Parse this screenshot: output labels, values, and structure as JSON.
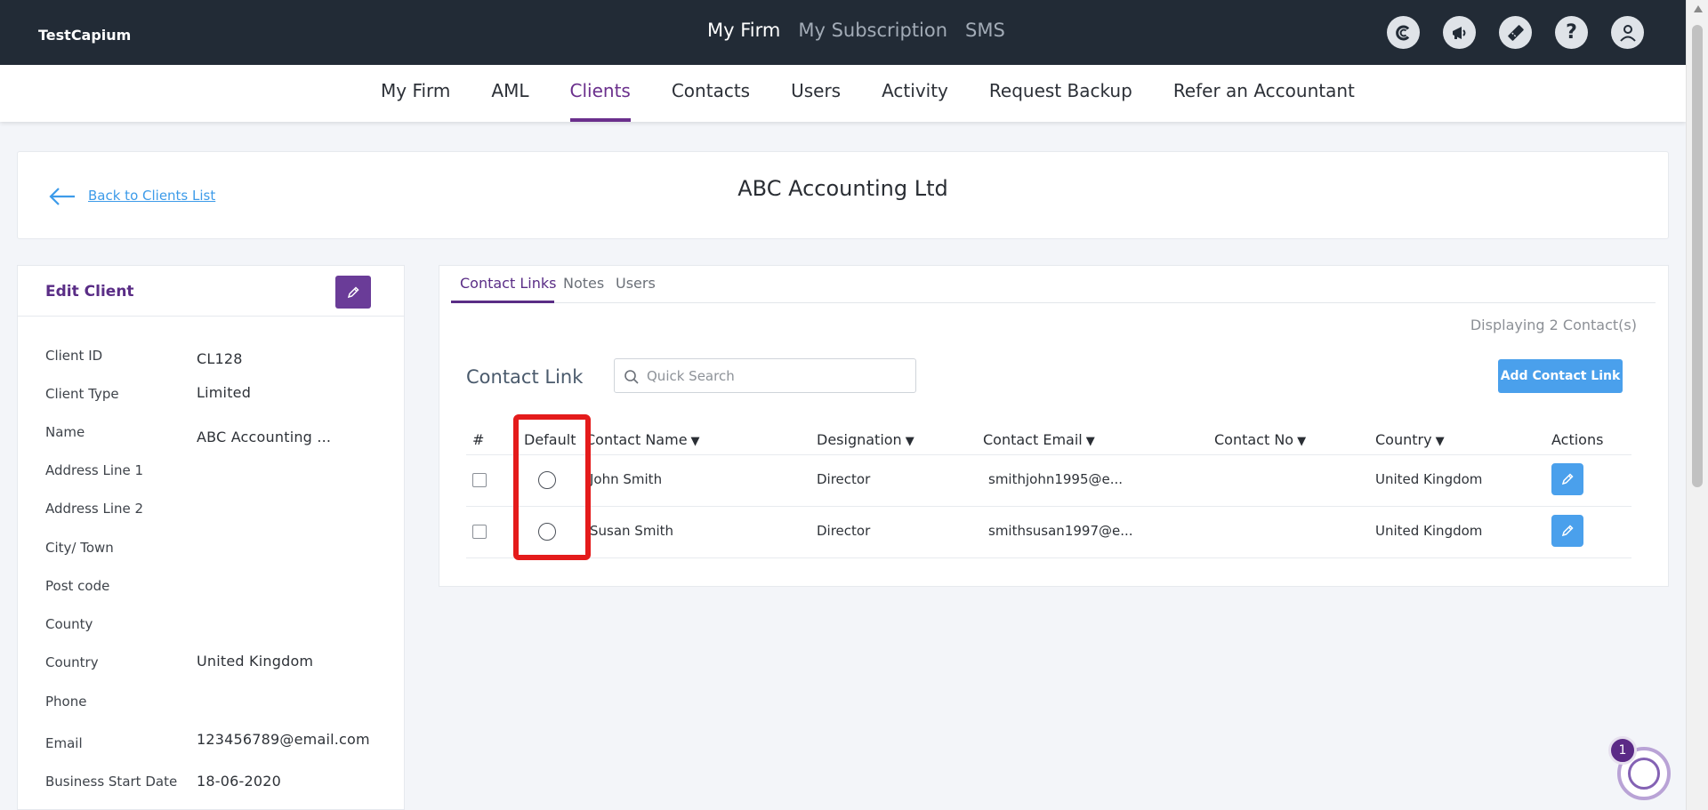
{
  "app": {
    "brand": "TestCapium",
    "top_nav": [
      "My Firm",
      "My Subscription",
      "SMS"
    ],
    "top_icons": [
      "capium-icon",
      "megaphone-icon",
      "ticket-icon",
      "help-icon",
      "user-icon"
    ],
    "help_glyph": "?"
  },
  "sub_nav": [
    "My Firm",
    "AML",
    "Clients",
    "Contacts",
    "Users",
    "Activity",
    "Request Backup",
    "Refer an Accountant"
  ],
  "sub_nav_active": "Clients",
  "header": {
    "back_link": "Back to Clients List",
    "client_title": "ABC Accounting Ltd"
  },
  "edit_client": {
    "title": "Edit Client",
    "fields": [
      {
        "label": "Client ID",
        "value": "CL128"
      },
      {
        "label": "Client Type",
        "value": "Limited"
      },
      {
        "label": "Name",
        "value": "ABC Accounting ..."
      },
      {
        "label": "Address Line 1",
        "value": ""
      },
      {
        "label": "Address Line 2",
        "value": ""
      },
      {
        "label": "City/ Town",
        "value": ""
      },
      {
        "label": "Post code",
        "value": ""
      },
      {
        "label": "County",
        "value": ""
      },
      {
        "label": "Country",
        "value": "United Kingdom"
      },
      {
        "label": "Phone",
        "value": ""
      },
      {
        "label": "Email",
        "value": "123456789@email.com"
      },
      {
        "label": "Business Start Date",
        "value": "18-06-2020"
      }
    ]
  },
  "tabs": [
    "Contact Links",
    "Notes",
    "Users"
  ],
  "contact_link": {
    "count_text": "Displaying 2 Contact(s)",
    "title": "Contact Link",
    "search_placeholder": "Quick Search",
    "add_button": "Add Contact Link",
    "sort_caret": "▼",
    "columns": [
      "#",
      "Default",
      "Contact Name",
      "Designation",
      "Contact Email",
      "Contact No",
      "Country",
      "Actions"
    ],
    "rows": [
      {
        "name": "John Smith",
        "designation": "Director",
        "email": "smithjohn1995@e...",
        "phone": "",
        "country": "United Kingdom"
      },
      {
        "name": "Susan Smith",
        "designation": "Director",
        "email": "smithsusan1997@e...",
        "phone": "",
        "country": "United Kingdom"
      }
    ]
  },
  "chat": {
    "badge": "1"
  },
  "colors": {
    "topbar": "#222b36",
    "accent_purple": "#5a2d86",
    "button_blue": "#4aa0ec",
    "highlight_red": "#e41b1b"
  }
}
